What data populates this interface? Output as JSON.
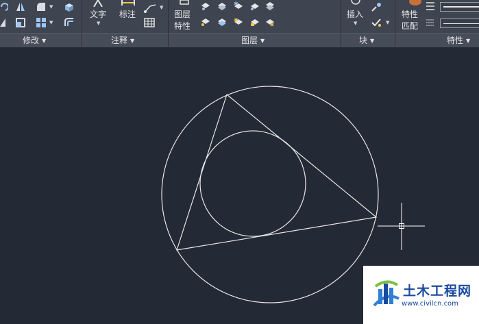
{
  "ribbon": {
    "panels": {
      "modify": "修改",
      "annotation": "注释",
      "layers": "图层",
      "block": "块",
      "properties": "特性"
    },
    "buttons": {
      "text": "文字",
      "dimension": "标注",
      "layer_properties_line1": "图层",
      "layer_properties_line2": "特性",
      "insert": "插入",
      "match_properties_line1": "特性",
      "match_properties_line2": "匹配"
    }
  },
  "watermark": {
    "name": "土木工程网",
    "url": "www.civilcn.com"
  },
  "colors": {
    "ribbon_bg": "#3e4450",
    "canvas_bg": "#242a35",
    "geometry_stroke": "#e8e8e8",
    "watermark_blue": "#1a4aa0"
  }
}
